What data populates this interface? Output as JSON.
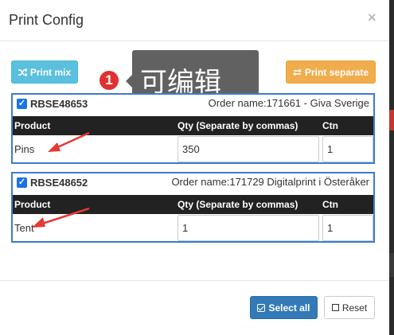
{
  "modal": {
    "title": "Print Config",
    "close_glyph": "×"
  },
  "toolbar": {
    "print_mix_label": "Print mix",
    "print_mix_icon": "shuffle-icon",
    "print_separate_label": "Print separate",
    "print_separate_icon": "swap-arrows-icon"
  },
  "annotation": {
    "badge_number": "1",
    "tooltip_text": "可编辑",
    "arrow_color": "#e53935"
  },
  "table_headers": {
    "product": "Product",
    "qty": "Qty (Separate by commas)",
    "ctn": "Ctn"
  },
  "orders": [
    {
      "checked": true,
      "id": "RBSE48653",
      "order_name": "Order name:171661 - Giva Sverige",
      "product": "Pins",
      "qty": "350",
      "ctn": "1"
    },
    {
      "checked": true,
      "id": "RBSE48652",
      "order_name": "Order name:171729 Digitalprint i Österåker",
      "product": "Tent",
      "qty": "1",
      "ctn": "1"
    }
  ],
  "footer": {
    "select_all_label": "Select all",
    "reset_label": "Reset"
  },
  "colors": {
    "info": "#5bc0de",
    "warning": "#f0ad4e",
    "primary": "#337ab7",
    "order_border": "#3c7bd0",
    "table_header": "#222222"
  }
}
